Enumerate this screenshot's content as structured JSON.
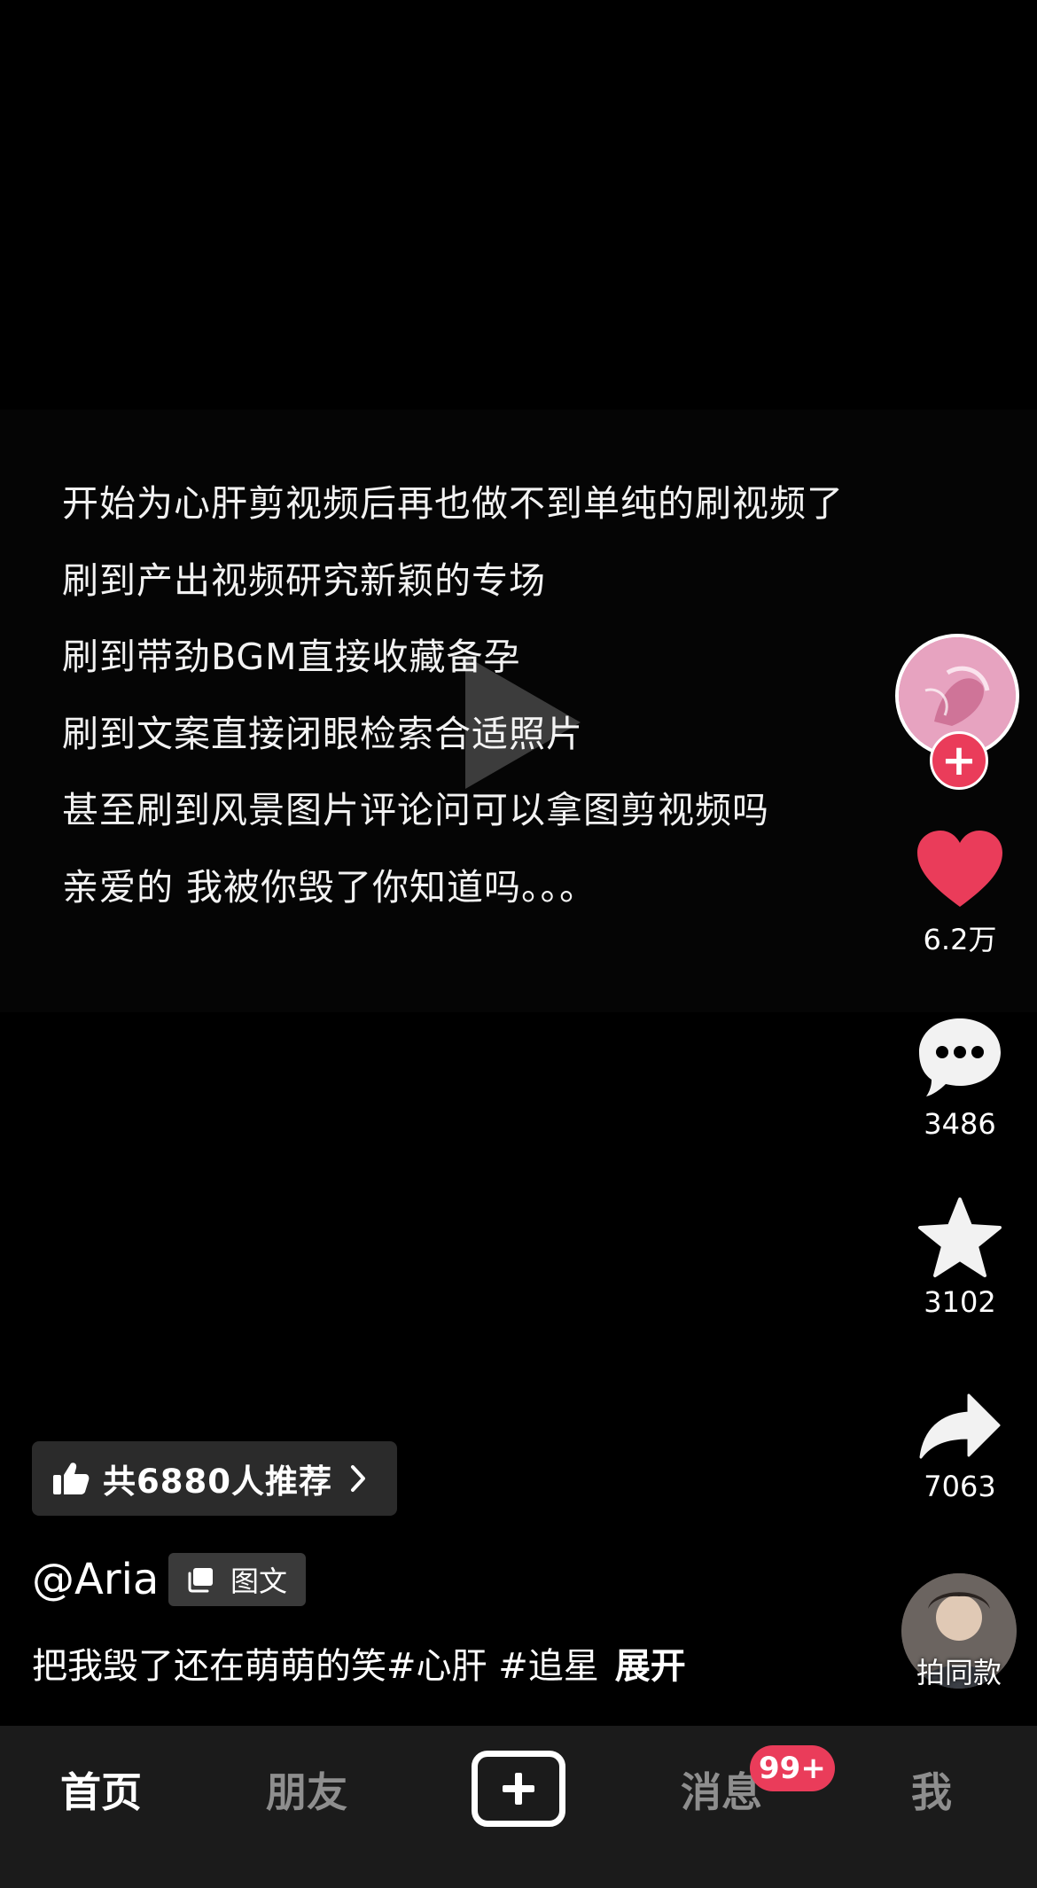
{
  "caption": {
    "lines": [
      "开始为心肝剪视频后再也做不到单纯的刷视频了",
      "刷到产出视频研究新颖的专场",
      "刷到带劲BGM直接收藏备孕",
      "刷到文案直接闭眼检索合适照片",
      "甚至刷到风景图片评论问可以拿图剪视频吗",
      "亲爱的 我被你毁了你知道吗。。。"
    ]
  },
  "rail": {
    "follow_label": "+",
    "like_count": "6.2万",
    "comment_count": "3486",
    "favorite_count": "3102",
    "share_count": "7063",
    "music_label": "拍同款"
  },
  "post": {
    "recommend_text": "共6880人推荐",
    "author": "@Aria",
    "type_label": "图文",
    "desc_text": "把我毁了还在萌萌的笑",
    "tags": [
      "#心肝",
      "#追星"
    ],
    "expand_label": "展开"
  },
  "nav": {
    "home": "首页",
    "friends": "朋友",
    "messages": "消息",
    "me": "我",
    "messages_badge": "99+"
  },
  "colors": {
    "accent": "#ea3c5a",
    "background": "#000000",
    "nav_background": "#1b1b1b"
  }
}
